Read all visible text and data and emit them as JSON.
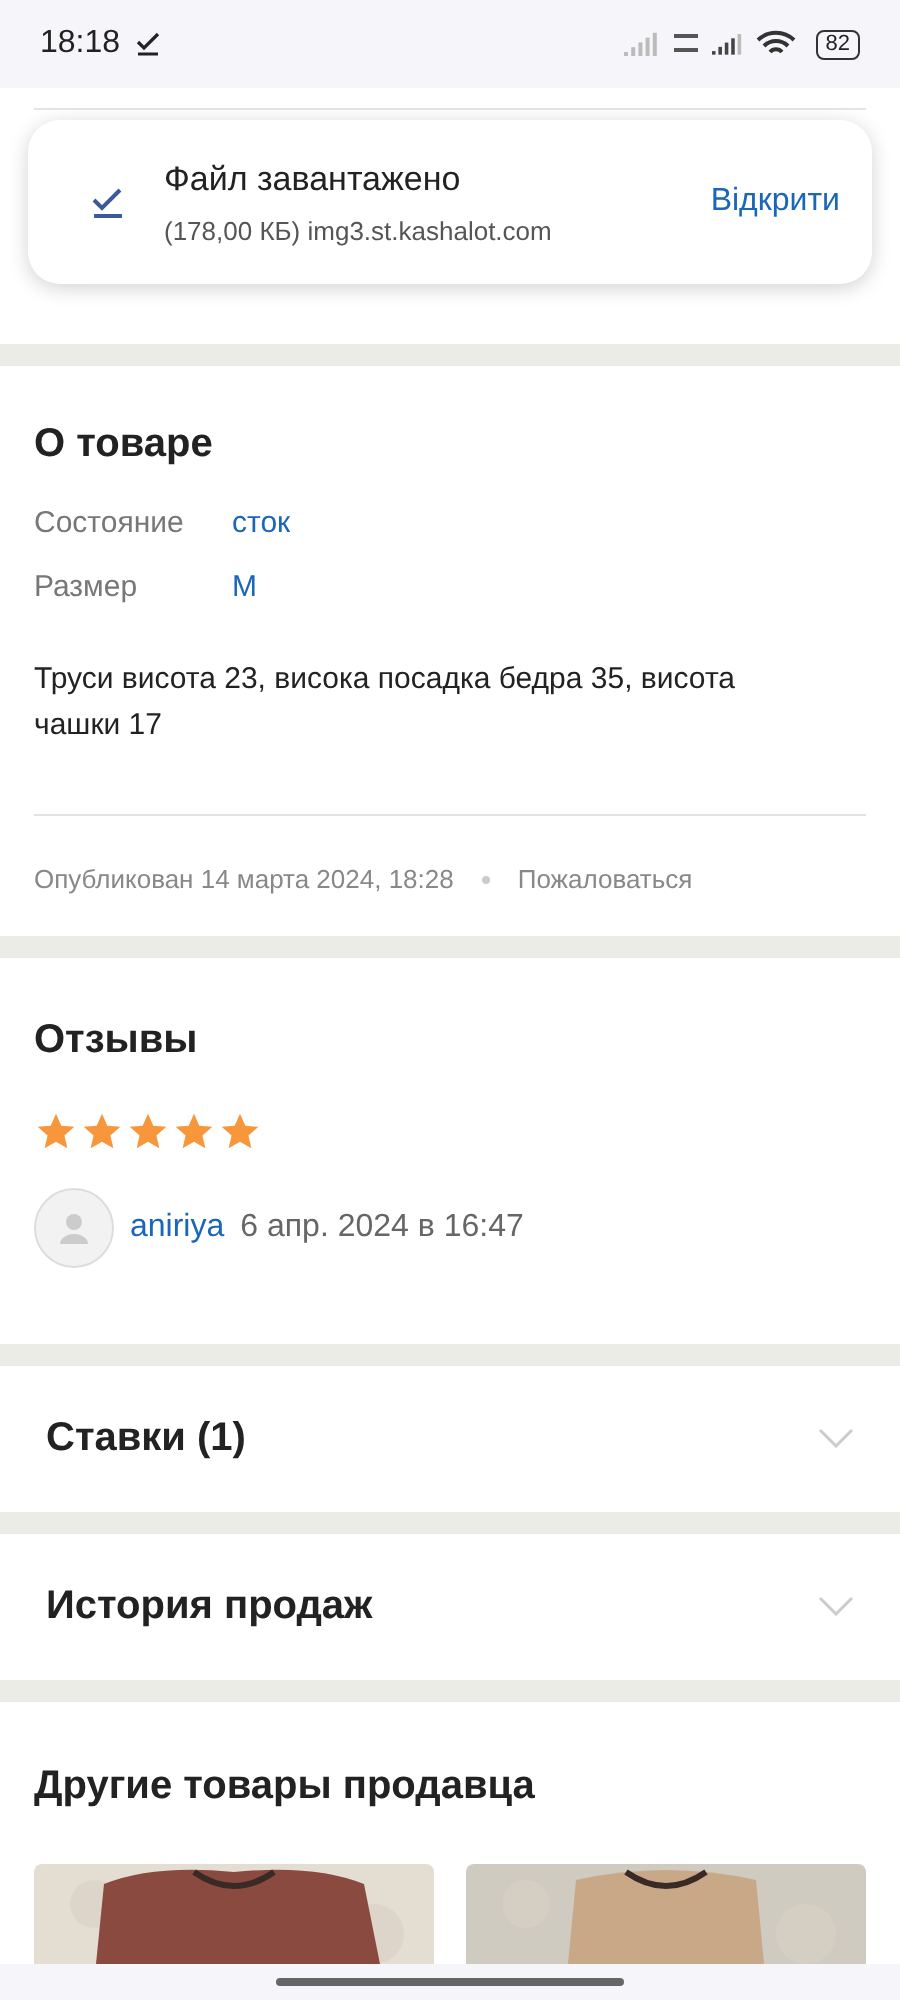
{
  "status_bar": {
    "time": "18:18",
    "battery": "82"
  },
  "notification": {
    "title": "Файл завантажено",
    "subtitle": "(178,00 КБ) img3.st.kashalot.com",
    "action": "Відкрити"
  },
  "about": {
    "title": "О товаре",
    "properties": [
      {
        "label": "Состояние",
        "value": "сток"
      },
      {
        "label": "Размер",
        "value": "M"
      }
    ],
    "description": "Труси висота 23, висока посадка бедра 35, висота чашки 17",
    "published": "Опубликован 14 марта 2024, 18:28",
    "report": "Пожаловаться"
  },
  "reviews": {
    "title": "Отзывы",
    "stars": 5,
    "author": "aniriya",
    "date": "6 апр. 2024 в 16:47"
  },
  "accordions": [
    {
      "title": "Ставки (1)",
      "expanded": false
    },
    {
      "title": "История продаж",
      "expanded": false
    }
  ],
  "other_items": {
    "title": "Другие товары продавца"
  }
}
